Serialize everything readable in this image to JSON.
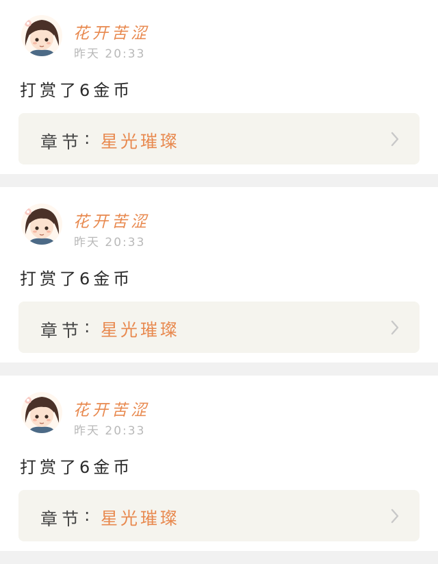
{
  "feed": {
    "items": [
      {
        "user_name": "花开苦涩",
        "time": "昨天 20:33",
        "message": "打赏了6金币",
        "chapter_prefix": "章节",
        "chapter_colon": ":",
        "chapter_title": "星光璀璨",
        "avatar_icon": "user-avatar-icon",
        "chevron_icon": "chevron-right-icon"
      },
      {
        "user_name": "花开苦涩",
        "time": "昨天 20:33",
        "message": "打赏了6金币",
        "chapter_prefix": "章节",
        "chapter_colon": ":",
        "chapter_title": "星光璀璨",
        "avatar_icon": "user-avatar-icon",
        "chevron_icon": "chevron-right-icon"
      },
      {
        "user_name": "花开苦涩",
        "time": "昨天 20:33",
        "message": "打赏了6金币",
        "chapter_prefix": "章节",
        "chapter_colon": ":",
        "chapter_title": "星光璀璨",
        "avatar_icon": "user-avatar-icon",
        "chevron_icon": "chevron-right-icon"
      }
    ]
  },
  "colors": {
    "page_background": "#f1f1f1",
    "card_background": "#ffffff",
    "accent": "#e8894f",
    "timestamp": "#b9b9b9",
    "message_text": "#2a2a2a",
    "chapter_box_background": "#f5f4ee",
    "chapter_label": "#444444",
    "chevron": "#c8c8c8"
  }
}
